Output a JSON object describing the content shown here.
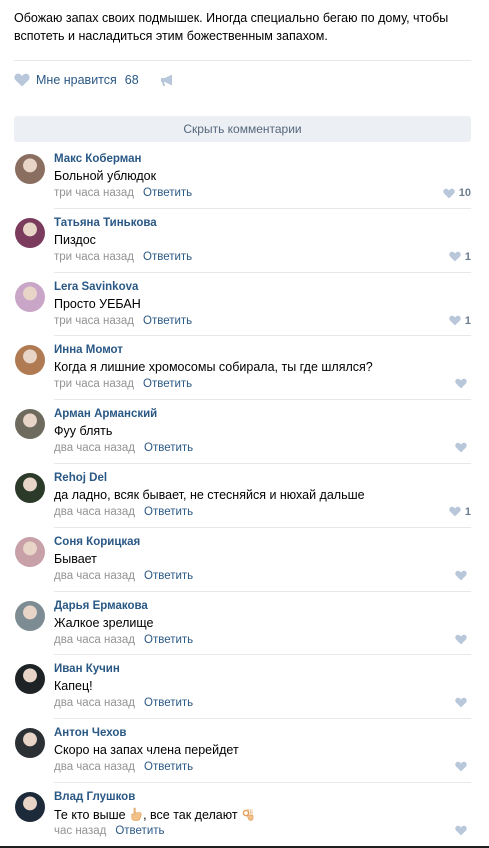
{
  "post": {
    "text": "Обожаю запах своих подмышек. Иногда специально бегаю по дому, чтобы вспотеть и насладиться этим божественным запахом.",
    "like_label": "Мне нравится",
    "like_count": "68",
    "hide_comments_label": "Скрыть комментарии"
  },
  "colors": {
    "link": "#2a5885",
    "meta_gray": "#939393",
    "divider": "#e7e8ec",
    "hide_button_bg": "#eceff3",
    "like_icon": "#b8c7d9"
  },
  "icons": {
    "like": "heart-icon",
    "share": "megaphone-icon",
    "comment_like": "heart-icon"
  },
  "comments": [
    {
      "author": "Макс Коберман",
      "text": "Больной ублюдок",
      "time": "три часа назад",
      "reply": "Ответить",
      "likes": "10",
      "avatar_color": "#8a6f60"
    },
    {
      "author": "Татьяна Тинькова",
      "text": "Пиздос",
      "time": "три часа назад",
      "reply": "Ответить",
      "likes": "1",
      "avatar_color": "#7a3b5c"
    },
    {
      "author": "Lera Savinkova",
      "text": "Просто УЕБАН",
      "time": "три часа назад",
      "reply": "Ответить",
      "likes": "1",
      "avatar_color": "#c9a6c8"
    },
    {
      "author": "Инна Момот",
      "text": "Когда я лишние хромосомы собирала, ты где шлялся?",
      "time": "три часа назад",
      "reply": "Ответить",
      "likes": "",
      "avatar_color": "#b07a52"
    },
    {
      "author": "Арман Арманский",
      "text": "Фуу блять",
      "time": "два часа назад",
      "reply": "Ответить",
      "likes": "",
      "avatar_color": "#6e6a5e"
    },
    {
      "author": "Rehoj Del",
      "text": "да ладно, всяк бывает, не стесняйся и нюхай дальше",
      "time": "два часа назад",
      "reply": "Ответить",
      "likes": "1",
      "avatar_color": "#2c3a2a"
    },
    {
      "author": "Соня Корицкая",
      "text": "Бывает",
      "time": "два часа назад",
      "reply": "Ответить",
      "likes": "",
      "avatar_color": "#c8a0a8"
    },
    {
      "author": "Дарья Ермакова",
      "text": "Жалкое зрелище",
      "time": "два часа назад",
      "reply": "Ответить",
      "likes": "",
      "avatar_color": "#7d8c93"
    },
    {
      "author": "Иван Кучин",
      "text": "Капец!",
      "time": "два часа назад",
      "reply": "Ответить",
      "likes": "",
      "avatar_color": "#1e2326"
    },
    {
      "author": "Антон Чехов",
      "text": "Скоро на запах члена перейдет",
      "time": "два часа назад",
      "reply": "Ответить",
      "likes": "",
      "avatar_color": "#2b3035"
    },
    {
      "author": "Влад Глушков",
      "text_before": "Те кто выше",
      "text_middle": ", все так делают",
      "time": "час назад",
      "reply": "Ответить",
      "likes": "",
      "avatar_color": "#1d2a3a"
    }
  ]
}
